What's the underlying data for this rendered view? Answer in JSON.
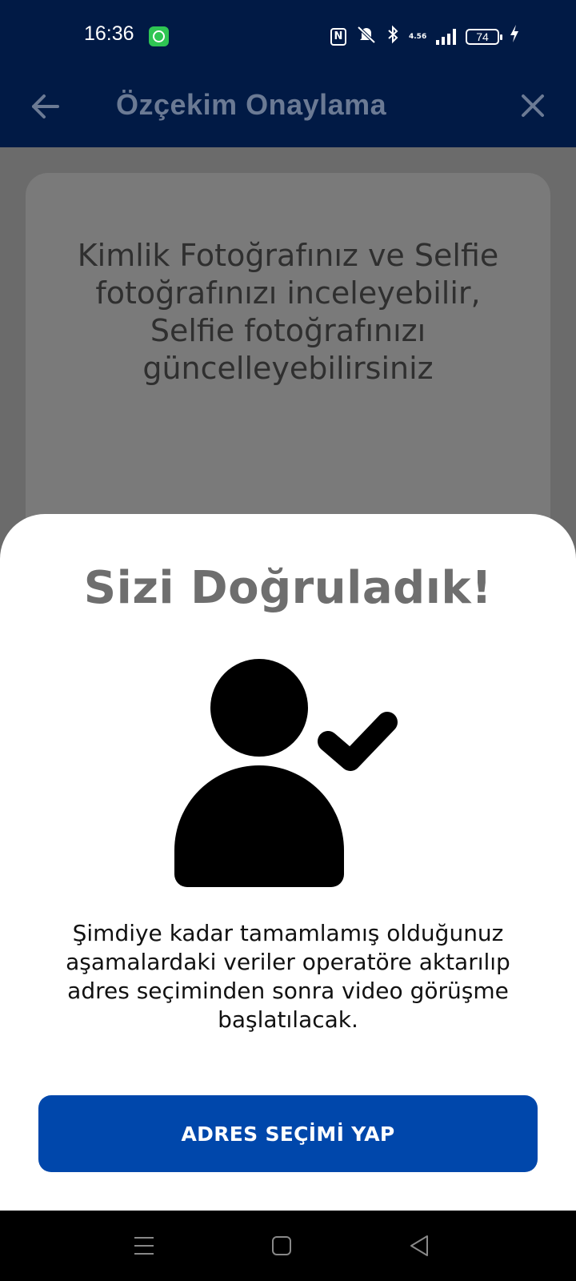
{
  "status_bar": {
    "time": "16:36",
    "net_speed": "4.56",
    "battery": "74",
    "icons": [
      "upload-app-icon",
      "nfc-icon",
      "silent-icon",
      "bluetooth-icon",
      "signal-icon",
      "battery-icon",
      "charging-icon"
    ]
  },
  "header": {
    "title": "Özçekim Onaylama",
    "back_icon": "arrow-left-icon",
    "close_icon": "close-icon"
  },
  "card": {
    "text": "Kimlik Fotoğrafınız ve Selfie fotoğrafınızı inceleyebilir, Selfie fotoğrafınızı güncelleyebilirsiniz"
  },
  "sheet": {
    "title": "Sizi Doğruladık!",
    "icon": "user-verified-icon",
    "description": "Şimdiye kadar tamamlamış olduğunuz aşamalardaki veriler operatöre aktarılıp adres seçiminden sonra video görüşme başlatılacak.",
    "button_label": "ADRES SEÇİMİ YAP"
  },
  "colors": {
    "header_bg": "#011a45",
    "overlay": "#6b6b6b",
    "button_bg": "#0047ab",
    "title_text": "#6e6e6e"
  }
}
